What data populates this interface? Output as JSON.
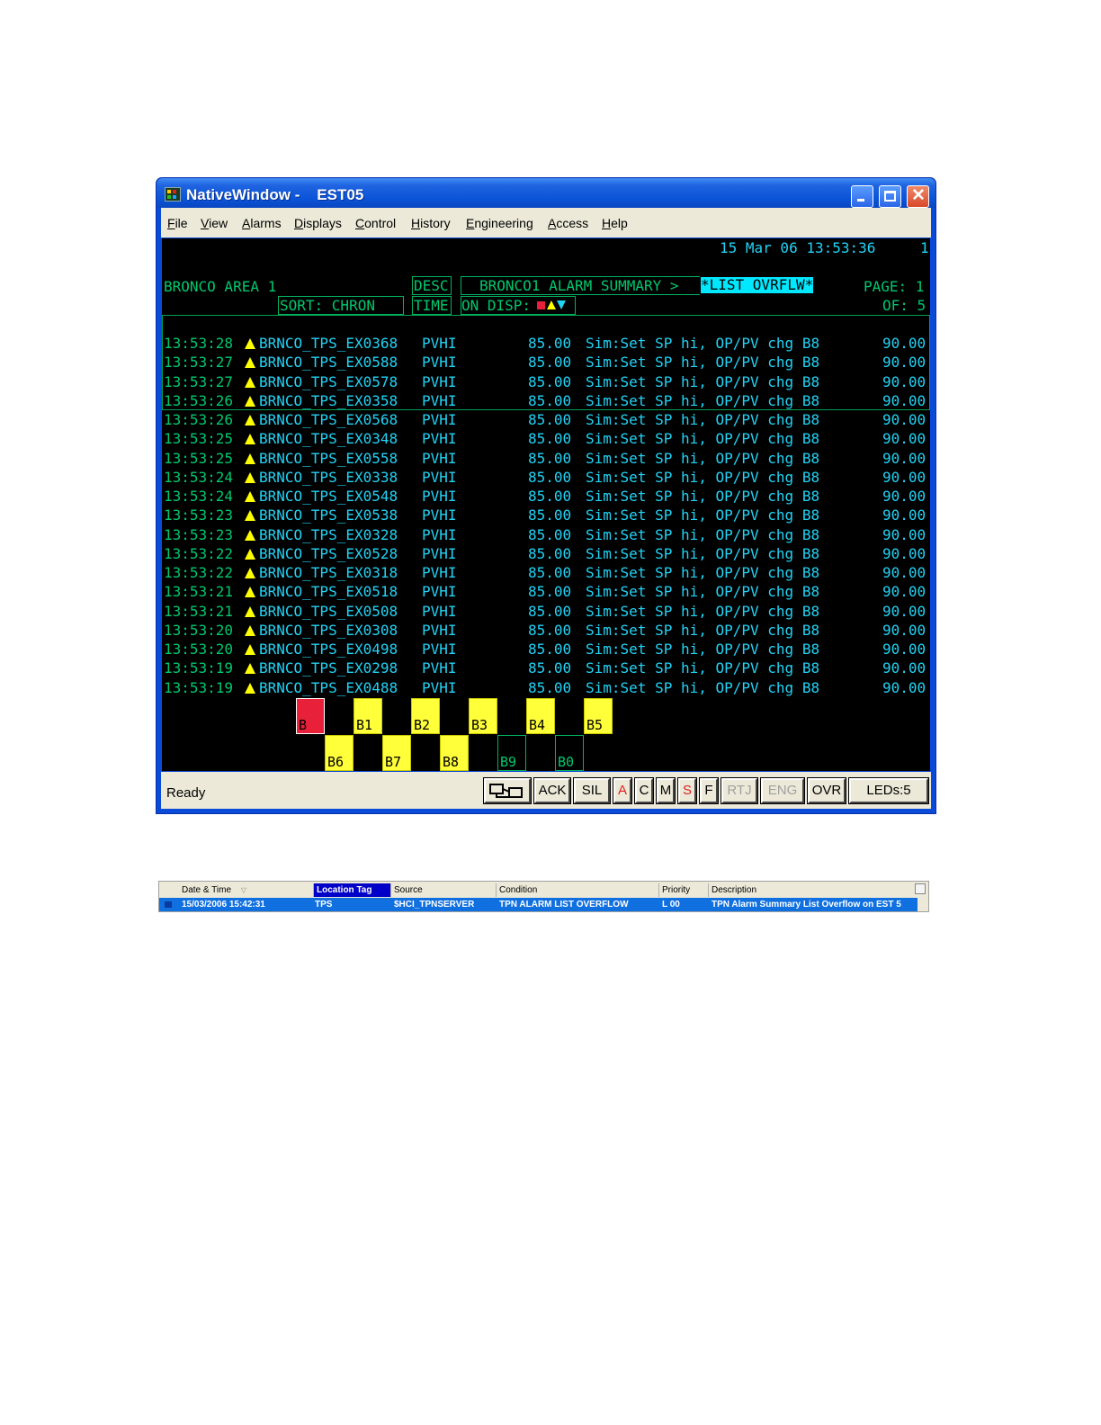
{
  "window": {
    "title": "NativeWindow -    EST05",
    "menu": [
      "File",
      "View",
      "Alarms",
      "Displays",
      "Control",
      "History",
      "Engineering",
      "Access",
      "Help"
    ]
  },
  "screen": {
    "datetime": "15 Mar 06 13:53:36",
    "corner": "1",
    "area": "BRONCO AREA 1",
    "sort": "SORT: CHRON",
    "desc": "DESC",
    "time": "TIME",
    "summary": "BRONCO1 ALARM SUMMARY >",
    "overflow": "*LIST OVRFLW*",
    "page_label": "PAGE: 1",
    "of_label": "OF: 5",
    "on_disp": "ON DISP:",
    "alarms": [
      {
        "time": "13:53:28",
        "tag": "BRNCO_TPS_EX0368",
        "type": "PVHI",
        "value": "85.00",
        "desc": "Sim:Set SP hi, OP/PV chg B8",
        "limit": "90.00"
      },
      {
        "time": "13:53:27",
        "tag": "BRNCO_TPS_EX0588",
        "type": "PVHI",
        "value": "85.00",
        "desc": "Sim:Set SP hi, OP/PV chg B8",
        "limit": "90.00"
      },
      {
        "time": "13:53:27",
        "tag": "BRNCO_TPS_EX0578",
        "type": "PVHI",
        "value": "85.00",
        "desc": "Sim:Set SP hi, OP/PV chg B8",
        "limit": "90.00"
      },
      {
        "time": "13:53:26",
        "tag": "BRNCO_TPS_EX0358",
        "type": "PVHI",
        "value": "85.00",
        "desc": "Sim:Set SP hi, OP/PV chg B8",
        "limit": "90.00"
      },
      {
        "time": "13:53:26",
        "tag": "BRNCO_TPS_EX0568",
        "type": "PVHI",
        "value": "85.00",
        "desc": "Sim:Set SP hi, OP/PV chg B8",
        "limit": "90.00"
      },
      {
        "time": "13:53:25",
        "tag": "BRNCO_TPS_EX0348",
        "type": "PVHI",
        "value": "85.00",
        "desc": "Sim:Set SP hi, OP/PV chg B8",
        "limit": "90.00"
      },
      {
        "time": "13:53:25",
        "tag": "BRNCO_TPS_EX0558",
        "type": "PVHI",
        "value": "85.00",
        "desc": "Sim:Set SP hi, OP/PV chg B8",
        "limit": "90.00"
      },
      {
        "time": "13:53:24",
        "tag": "BRNCO_TPS_EX0338",
        "type": "PVHI",
        "value": "85.00",
        "desc": "Sim:Set SP hi, OP/PV chg B8",
        "limit": "90.00"
      },
      {
        "time": "13:53:24",
        "tag": "BRNCO_TPS_EX0548",
        "type": "PVHI",
        "value": "85.00",
        "desc": "Sim:Set SP hi, OP/PV chg B8",
        "limit": "90.00"
      },
      {
        "time": "13:53:23",
        "tag": "BRNCO_TPS_EX0538",
        "type": "PVHI",
        "value": "85.00",
        "desc": "Sim:Set SP hi, OP/PV chg B8",
        "limit": "90.00"
      },
      {
        "time": "13:53:23",
        "tag": "BRNCO_TPS_EX0328",
        "type": "PVHI",
        "value": "85.00",
        "desc": "Sim:Set SP hi, OP/PV chg B8",
        "limit": "90.00"
      },
      {
        "time": "13:53:22",
        "tag": "BRNCO_TPS_EX0528",
        "type": "PVHI",
        "value": "85.00",
        "desc": "Sim:Set SP hi, OP/PV chg B8",
        "limit": "90.00"
      },
      {
        "time": "13:53:22",
        "tag": "BRNCO_TPS_EX0318",
        "type": "PVHI",
        "value": "85.00",
        "desc": "Sim:Set SP hi, OP/PV chg B8",
        "limit": "90.00"
      },
      {
        "time": "13:53:21",
        "tag": "BRNCO_TPS_EX0518",
        "type": "PVHI",
        "value": "85.00",
        "desc": "Sim:Set SP hi, OP/PV chg B8",
        "limit": "90.00"
      },
      {
        "time": "13:53:21",
        "tag": "BRNCO_TPS_EX0508",
        "type": "PVHI",
        "value": "85.00",
        "desc": "Sim:Set SP hi, OP/PV chg B8",
        "limit": "90.00"
      },
      {
        "time": "13:53:20",
        "tag": "BRNCO_TPS_EX0308",
        "type": "PVHI",
        "value": "85.00",
        "desc": "Sim:Set SP hi, OP/PV chg B8",
        "limit": "90.00"
      },
      {
        "time": "13:53:20",
        "tag": "BRNCO_TPS_EX0498",
        "type": "PVHI",
        "value": "85.00",
        "desc": "Sim:Set SP hi, OP/PV chg B8",
        "limit": "90.00"
      },
      {
        "time": "13:53:19",
        "tag": "BRNCO_TPS_EX0298",
        "type": "PVHI",
        "value": "85.00",
        "desc": "Sim:Set SP hi, OP/PV chg B8",
        "limit": "90.00"
      },
      {
        "time": "13:53:19",
        "tag": "BRNCO_TPS_EX0488",
        "type": "PVHI",
        "value": "85.00",
        "desc": "Sim:Set SP hi, OP/PV chg B8",
        "limit": "90.00"
      }
    ],
    "blocks_top": [
      {
        "label": "B",
        "state": "red"
      },
      {
        "label": "B1",
        "state": "yellow"
      },
      {
        "label": "B2",
        "state": "yellow"
      },
      {
        "label": "B3",
        "state": "yellow"
      },
      {
        "label": "B4",
        "state": "yellow"
      },
      {
        "label": "B5",
        "state": "yellow"
      }
    ],
    "blocks_bottom": [
      {
        "label": "B6",
        "state": "yellow"
      },
      {
        "label": "B7",
        "state": "yellow"
      },
      {
        "label": "B8",
        "state": "yellow"
      },
      {
        "label": "B9",
        "state": "off"
      },
      {
        "label": "B0",
        "state": "off"
      }
    ]
  },
  "statusbar": {
    "status": "Ready",
    "buttons": [
      "ACK",
      "SIL",
      "A",
      "C",
      "M",
      "S",
      "F",
      "RTJ",
      "ENG",
      "OVR"
    ],
    "leds": "LEDs:5"
  },
  "alarm_grid": {
    "headers": [
      "Date & Time",
      "Location Tag",
      "Source",
      "Condition",
      "Priority",
      "Description"
    ],
    "row": {
      "datetime": "15/03/2006 15:42:31",
      "location": "TPS",
      "source": "$HCI_TPNSERVER",
      "condition": "TPN ALARM LIST OVERFLOW",
      "priority": "L 00",
      "description": "TPN Alarm Summary List Overflow on EST 5"
    }
  },
  "colors": {
    "terminal_green": "#00c86e",
    "terminal_cyan": "#22d3f5",
    "alarm_yellow": "#ffff3a",
    "alarm_red": "#e8203a",
    "xp_blue": "#0a54d8"
  }
}
